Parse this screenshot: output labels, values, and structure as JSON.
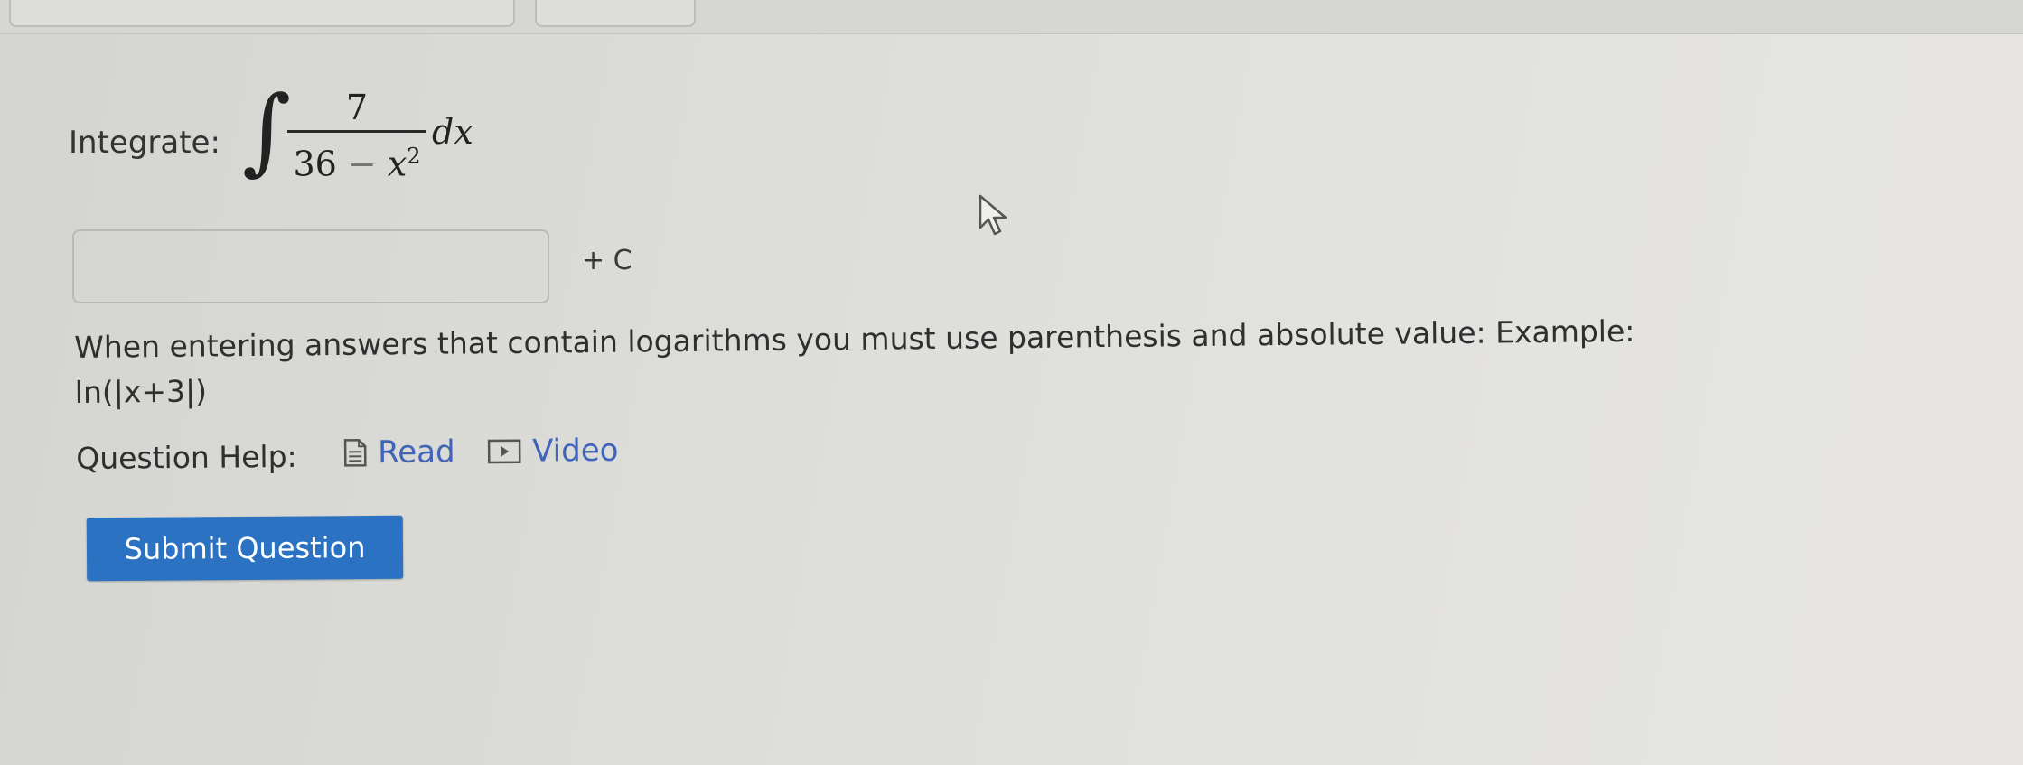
{
  "question": {
    "prompt_label": "Integrate:",
    "integral_symbol": "∫",
    "numerator": "7",
    "denominator_constant": "36",
    "denominator_operator": "−",
    "denominator_variable": "x",
    "denominator_exponent": "2",
    "differential": "dx"
  },
  "answer": {
    "value": "",
    "suffix": "+ C"
  },
  "instruction": {
    "text": "When entering answers that contain logarithms you must use parenthesis and absolute value: Example:",
    "example": "ln(|x+3|)"
  },
  "help": {
    "label": "Question Help:",
    "read_label": "Read",
    "video_label": "Video"
  },
  "actions": {
    "submit_label": "Submit Question"
  },
  "colors": {
    "link": "#3f64b8",
    "submit_bg": "#2b72c2"
  },
  "icons": {
    "read": "document-icon",
    "video": "play-icon",
    "cursor": "mouse-pointer-icon"
  }
}
